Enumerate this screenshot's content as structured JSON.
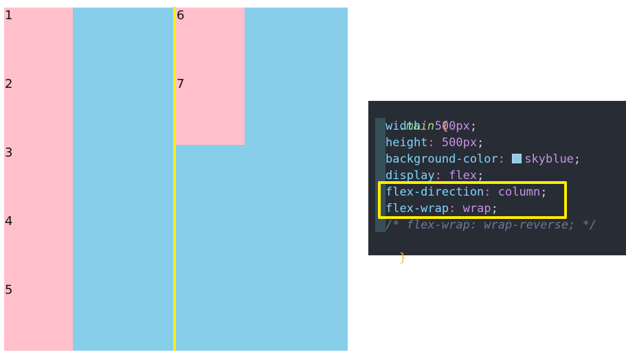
{
  "demo": {
    "items": [
      "1",
      "2",
      "3",
      "4",
      "5",
      "6",
      "7"
    ],
    "colors": {
      "container": "#87ceeb",
      "item": "#ffc0cb",
      "divider": "#ffee00"
    }
  },
  "code": {
    "selector": ".main",
    "open_brace": "{",
    "close_brace": "}",
    "lines": [
      {
        "prop": "width",
        "value": "500px"
      },
      {
        "prop": "height",
        "value": "500px"
      },
      {
        "prop": "background-color",
        "value": "skyblue"
      },
      {
        "prop": "display",
        "value": "flex"
      },
      {
        "prop": "flex-direction",
        "value": "column"
      },
      {
        "prop": "flex-wrap",
        "value": "wrap"
      }
    ],
    "comment": "/* flex-wrap: wrap-reverse; */",
    "highlight_color": "#ffee00"
  }
}
